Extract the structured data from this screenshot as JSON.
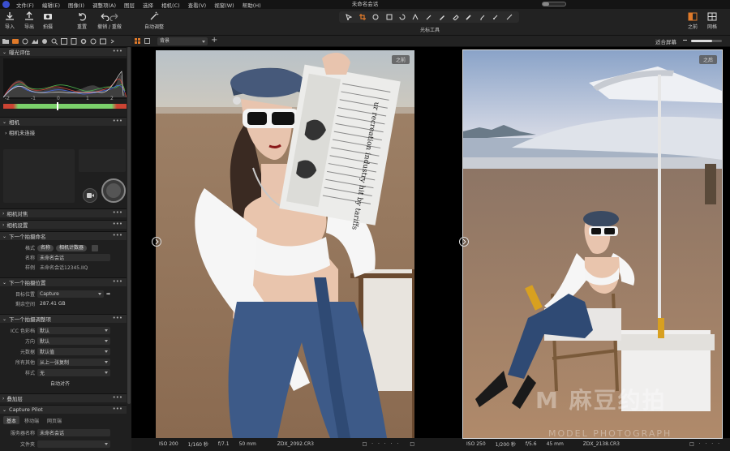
{
  "menu": {
    "items": [
      "文件(F)",
      "编辑(E)",
      "图像(I)",
      "调整项(A)",
      "图层",
      "选择",
      "相机(C)",
      "查看(V)",
      "视窗(W)",
      "帮助(H)"
    ],
    "window_title": "未命名会话",
    "progress": 0.3
  },
  "toolbar": {
    "import": "导入",
    "export": "导出",
    "capture": "拍摄",
    "reset": "重置",
    "undo_redo": "撤销 / 重做",
    "auto_adjust": "自动调整",
    "cursor_tools": "光标工具",
    "before": "之前",
    "grid": "网格"
  },
  "viewer_bar": {
    "preset": "背景",
    "fit_label": "适合屏幕"
  },
  "sidebar": {
    "exposure": {
      "title": "曝光评估",
      "ticks": [
        "-2",
        "-1",
        "0",
        "1",
        "2"
      ]
    },
    "camera": {
      "title": "相机",
      "status": "相机未连接"
    },
    "camera_focus": "相机对焦",
    "camera_settings": "相机设置",
    "next_name": {
      "title": "下一个拍摄命名",
      "format_label": "格式",
      "format_tag1": "名称",
      "format_tag2": "相机计数器",
      "name_label": "名称",
      "name_value": "未命名会话",
      "sample_label": "样例",
      "sample_value": "未命名会话12345.IIQ"
    },
    "next_location": {
      "title": "下一个拍摄位置",
      "target_label": "目标位置",
      "target_value": "Capture",
      "space_label": "剩余空间",
      "space_value": "287.41 GB"
    },
    "next_adjust": {
      "title": "下一个拍摄调整项",
      "rows": [
        {
          "label": "ICC 色彩档",
          "value": "默认"
        },
        {
          "label": "方向",
          "value": "默认"
        },
        {
          "label": "元数据",
          "value": "默认值"
        },
        {
          "label": "所有其他",
          "value": "从上一张复制"
        },
        {
          "label": "样式",
          "value": "无"
        }
      ],
      "auto_align": "自动对齐"
    },
    "overlay": "叠加层",
    "pilot": {
      "title": "Capture Pilot",
      "tabs": [
        "基本",
        "移动端",
        "网页端"
      ],
      "server_label": "服务器名称",
      "server_value": "未命名会话",
      "file_label": "文件夹"
    }
  },
  "left_image": {
    "badge": "之前",
    "iso": "ISO 200",
    "shutter": "1/160 秒",
    "aperture": "f/7.1",
    "focal": "50 mm",
    "filename": "ZDX_2092.CR3"
  },
  "right_image": {
    "badge": "之后",
    "iso": "ISO 250",
    "shutter": "1/200 秒",
    "aperture": "f/5.6",
    "focal": "45 mm",
    "filename": "ZDX_2138.CR3"
  },
  "newspaper": {
    "headline": "ur recreation industry hit by tariffs"
  },
  "watermark": {
    "main": "M 麻豆约拍",
    "sub": "MODEL PHOTOGRAPH"
  }
}
